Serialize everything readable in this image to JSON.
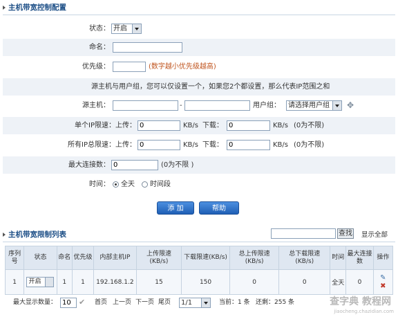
{
  "section1_title": "主机带宽控制配置",
  "form": {
    "status_label": "状态：",
    "status_value": "开启",
    "name_label": "命名：",
    "priority_label": "优先级：",
    "priority_hint": "(数字越小优先级越高)",
    "note": "源主机与用户组，您可以仅设置一个，如果您2个都设置，那么代表IP范围之和",
    "source_label": "源主机：",
    "dash": "-",
    "usergroup_label": "用户组：",
    "usergroup_value": "请选择用户组",
    "single_label": "单个IP限速：上传：",
    "single_up": "0",
    "kbs1": "KB/s",
    "down_label1": "下载：",
    "single_down": "0",
    "kbs2": "KB/s",
    "unlimited1": "(0为不限)",
    "all_label": "所有IP总限速：上传：",
    "all_up": "0",
    "kbs3": "KB/s",
    "down_label2": "下载：",
    "all_down": "0",
    "kbs4": "KB/s",
    "unlimited2": "(0为不限)",
    "maxconn_label": "最大连接数：",
    "maxconn_value": "0",
    "unlimited3": "(0为不限 )",
    "time_label": "时间：",
    "time_opt1": "全天",
    "time_opt2": "时间段",
    "add_button": "添 加",
    "help_button": "帮助"
  },
  "section2_title": "主机带宽限制列表",
  "search_button": "查找",
  "show_all": "显示全部",
  "table": {
    "headers": [
      "序列号",
      "状态",
      "命名",
      "优先级",
      "内部主机IP",
      "上传限速(KB/s)",
      "下载限速(KB/s)",
      "总上传限速(KB/s)",
      "总下载限速(KB/s)",
      "时间",
      "最大连接数",
      "操作"
    ],
    "row": {
      "seq": "1",
      "status": "开启",
      "name": "1",
      "priority": "1",
      "ip": "192.168.1.2",
      "up": "15",
      "down": "150",
      "total_up": "0",
      "total_down": "0",
      "time": "全天",
      "maxconn": "0"
    }
  },
  "pager": {
    "max_label": "最大显示数量：",
    "max_value": "10",
    "first": "首页",
    "prev": "上一页",
    "next": "下一页",
    "last": "尾页",
    "page_value": "1/1",
    "current": "当前：1 条",
    "remaining": "还剩：255 条"
  },
  "watermark": "查字典 教程网",
  "watermark_url": "jiaocheng.chazidian.com"
}
